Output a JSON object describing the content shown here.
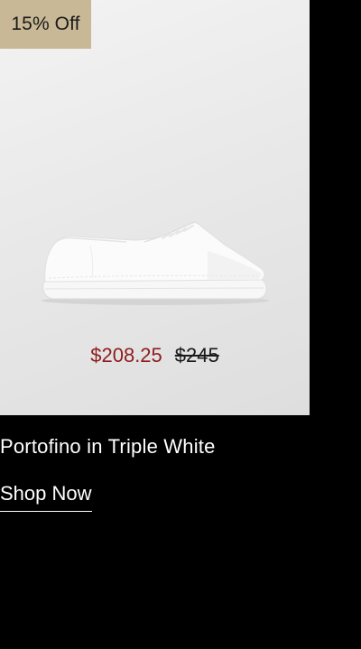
{
  "badge": {
    "label": "15% Off"
  },
  "product": {
    "name": "Portofino in Triple White",
    "sale_price": "$208.25",
    "original_price": "$245",
    "image_icon": "shoe-product-image"
  },
  "cta": {
    "label": "Shop Now"
  },
  "colors": {
    "badge_bg": "#c9b896",
    "sale_price": "#8e1d1d",
    "page_bg": "#000000"
  }
}
